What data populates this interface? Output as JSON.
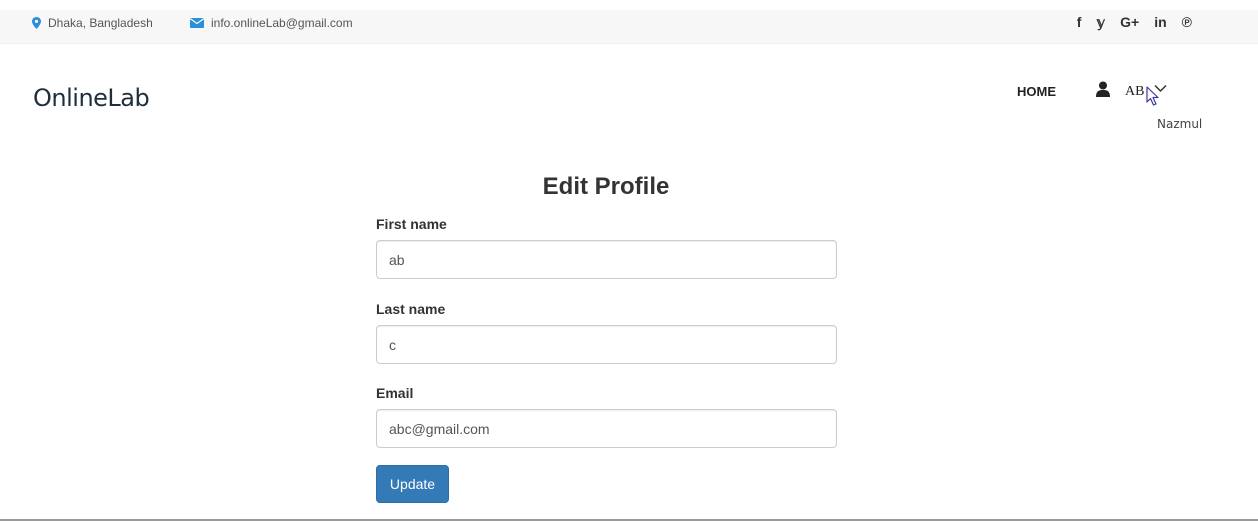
{
  "topbar": {
    "location": "Dhaka, Bangladesh",
    "email": "info.onlineLab@gmail.com",
    "social": [
      {
        "name": "facebook",
        "glyph": "f"
      },
      {
        "name": "twitter",
        "glyph": "𝕪"
      },
      {
        "name": "google-plus",
        "glyph": "G+"
      },
      {
        "name": "linkedin",
        "glyph": "in"
      },
      {
        "name": "pinterest",
        "glyph": "℗"
      }
    ]
  },
  "header": {
    "logo": "OnlineLab",
    "home_label": "HOME",
    "user_initials": "AB",
    "user_name": "Nazmul"
  },
  "form": {
    "title": "Edit Profile",
    "first_name_label": "First name",
    "first_name_value": "ab",
    "last_name_label": "Last name",
    "last_name_value": "c",
    "email_label": "Email",
    "email_value": "abc@gmail.com",
    "submit_label": "Update"
  },
  "colors": {
    "accent": "#337ab7",
    "icon_blue": "#2a8fd6",
    "topbar_bg": "#f7f7f7"
  }
}
